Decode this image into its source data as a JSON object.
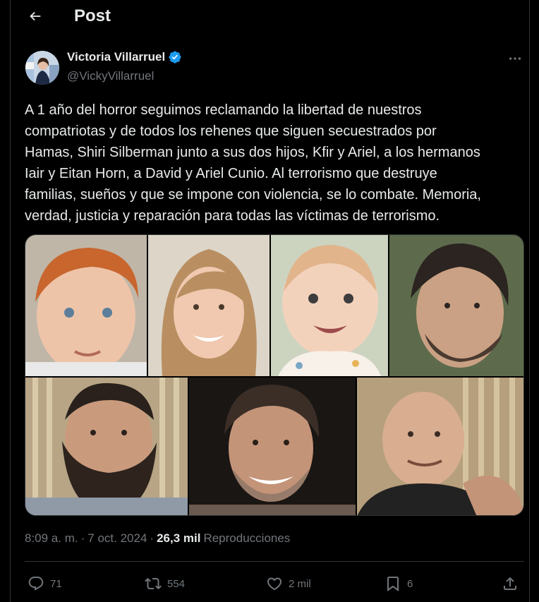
{
  "header": {
    "title": "Post"
  },
  "author": {
    "name": "Victoria Villarruel",
    "handle": "@VickyVillarruel"
  },
  "post": {
    "text": "A 1 año del horror seguimos reclamando la libertad de nuestros\ncompatriotas y de todos los rehenes que siguen secuestrados por\nHamas, Shiri Silberman junto a sus dos hijos, Kfir y Ariel, a los hermanos\nIair y Eitan Horn, a David y Ariel Cunio. Al terrorismo que destruye\nfamilias, sueños y que se impone con violencia, se lo combate. Memoria,\nverdad, justicia y reparación para todas las víctimas de terrorismo."
  },
  "meta": {
    "time": "8:09 a. m.",
    "sep1": "·",
    "date": "7 oct. 2024",
    "sep2": "·",
    "views_count": "26,3 mil",
    "views_label": "Reproducciones"
  },
  "actions": {
    "replies": "71",
    "reposts": "554",
    "likes": "2 mil",
    "bookmarks": "6"
  },
  "colors": {
    "background": "#000000",
    "text": "#e7e9ea",
    "muted": "#71767b",
    "border": "#2f3336",
    "verified": "#1d9bf0"
  },
  "icons": [
    "back-arrow-icon",
    "verified-badge-icon",
    "more-icon",
    "reply-icon",
    "repost-icon",
    "like-icon",
    "bookmark-icon",
    "share-icon"
  ]
}
